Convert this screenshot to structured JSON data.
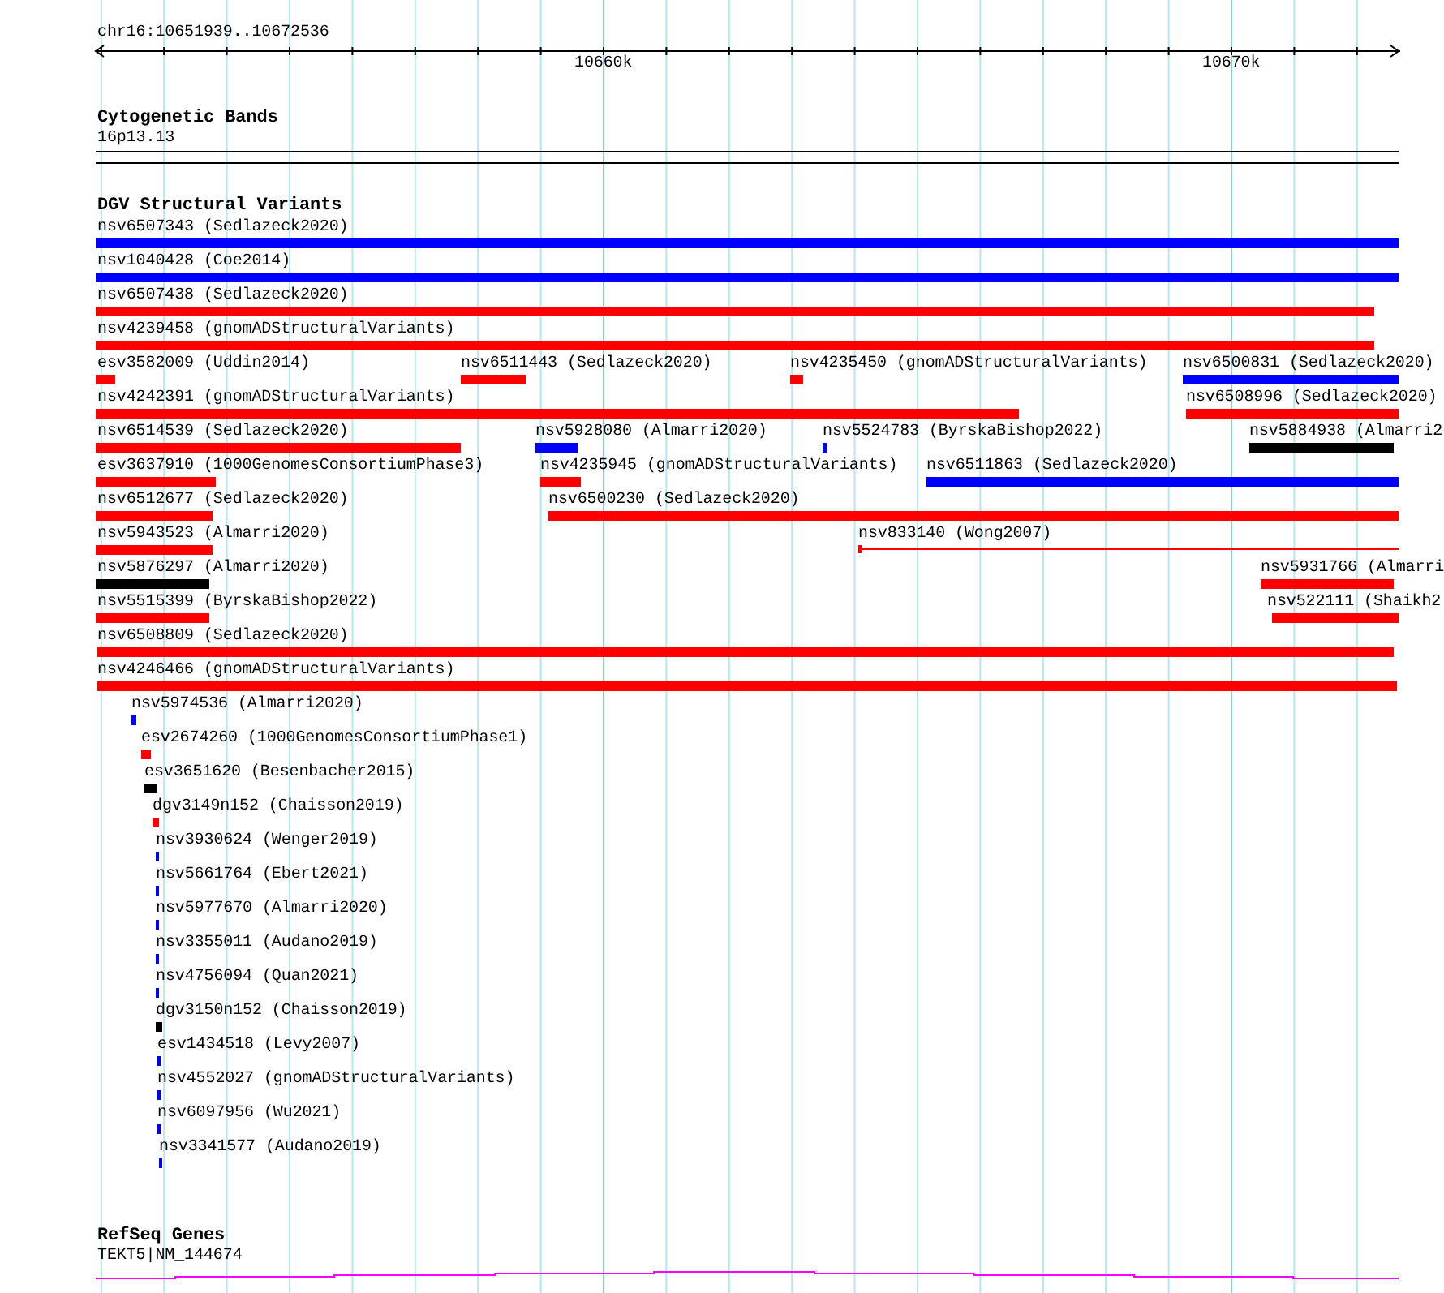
{
  "location": "chr16:10651939..10672536",
  "ruler": {
    "ticks": [
      "10660k",
      "10670k"
    ]
  },
  "cytogenetic_bands": {
    "title": "Cytogenetic Bands",
    "label": "16p13.13"
  },
  "dgv_structural_variants": {
    "title": "DGV Structural Variants",
    "features": [
      {
        "label": "nsv6507343 (Sedlazeck2020)",
        "color": "#0000ff",
        "kind": "bar"
      },
      {
        "label": "nsv1040428 (Coe2014)",
        "color": "#0000ff",
        "kind": "bar"
      },
      {
        "label": "nsv6507438 (Sedlazeck2020)",
        "color": "#ff0000",
        "kind": "bar"
      },
      {
        "label": "nsv4239458 (gnomADStructuralVariants)",
        "color": "#ff0000",
        "kind": "bar"
      },
      {
        "label": "esv3582009 (Uddin2014)",
        "color": "#ff0000",
        "kind": "bar"
      },
      {
        "label": "nsv6511443 (Sedlazeck2020)",
        "color": "#ff0000",
        "kind": "bar"
      },
      {
        "label": "nsv4235450 (gnomADStructuralVariants)",
        "color": "#ff0000",
        "kind": "bar"
      },
      {
        "label": "nsv6500831 (Sedlazeck2020)",
        "color": "#0000ff",
        "kind": "bar"
      },
      {
        "label": "nsv4242391 (gnomADStructuralVariants)",
        "color": "#ff0000",
        "kind": "bar"
      },
      {
        "label": "nsv6508996 (Sedlazeck2020)",
        "color": "#ff0000",
        "kind": "bar"
      },
      {
        "label": "nsv6514539 (Sedlazeck2020)",
        "color": "#ff0000",
        "kind": "bar"
      },
      {
        "label": "nsv5928080 (Almarri2020)",
        "color": "#0000ff",
        "kind": "bar"
      },
      {
        "label": "nsv5524783 (ByrskaBishop2022)",
        "color": "#0000ff",
        "kind": "bar"
      },
      {
        "label": "nsv5884938 (Almarri2",
        "color": "#000000",
        "kind": "bar"
      },
      {
        "label": "esv3637910 (1000GenomesConsortiumPhase3)",
        "color": "#ff0000",
        "kind": "bar"
      },
      {
        "label": "nsv4235945 (gnomADStructuralVariants)",
        "color": "#ff0000",
        "kind": "bar"
      },
      {
        "label": "nsv6511863 (Sedlazeck2020)",
        "color": "#0000ff",
        "kind": "bar"
      },
      {
        "label": "nsv6512677 (Sedlazeck2020)",
        "color": "#ff0000",
        "kind": "bar"
      },
      {
        "label": "nsv6500230 (Sedlazeck2020)",
        "color": "#ff0000",
        "kind": "bar"
      },
      {
        "label": "nsv5943523 (Almarri2020)",
        "color": "#ff0000",
        "kind": "bar"
      },
      {
        "label": "nsv833140 (Wong2007)",
        "color": "#ff0000",
        "kind": "line"
      },
      {
        "label": "nsv5876297 (Almarri2020)",
        "color": "#000000",
        "kind": "bar"
      },
      {
        "label": "nsv5931766 (Almarri",
        "color": "#ff0000",
        "kind": "bar"
      },
      {
        "label": "nsv5515399 (ByrskaBishop2022)",
        "color": "#ff0000",
        "kind": "bar"
      },
      {
        "label": "nsv522111 (Shaikh2",
        "color": "#ff0000",
        "kind": "bar"
      },
      {
        "label": "nsv6508809 (Sedlazeck2020)",
        "color": "#ff0000",
        "kind": "bar"
      },
      {
        "label": "nsv4246466 (gnomADStructuralVariants)",
        "color": "#ff0000",
        "kind": "bar"
      },
      {
        "label": "nsv5974536 (Almarri2020)",
        "color": "#0000ff",
        "kind": "bar"
      },
      {
        "label": "esv2674260 (1000GenomesConsortiumPhase1)",
        "color": "#ff0000",
        "kind": "bar"
      },
      {
        "label": "esv3651620 (Besenbacher2015)",
        "color": "#000000",
        "kind": "bar"
      },
      {
        "label": "dgv3149n152 (Chaisson2019)",
        "color": "#ff0000",
        "kind": "bar"
      },
      {
        "label": "nsv3930624 (Wenger2019)",
        "color": "#0000ff",
        "kind": "bar"
      },
      {
        "label": "nsv5661764 (Ebert2021)",
        "color": "#0000ff",
        "kind": "bar"
      },
      {
        "label": "nsv5977670 (Almarri2020)",
        "color": "#0000ff",
        "kind": "bar"
      },
      {
        "label": "nsv3355011 (Audano2019)",
        "color": "#0000ff",
        "kind": "bar"
      },
      {
        "label": "nsv4756094 (Quan2021)",
        "color": "#0000ff",
        "kind": "bar"
      },
      {
        "label": "dgv3150n152 (Chaisson2019)",
        "color": "#000000",
        "kind": "bar"
      },
      {
        "label": "esv1434518 (Levy2007)",
        "color": "#0000ff",
        "kind": "bar"
      },
      {
        "label": "nsv4552027 (gnomADStructuralVariants)",
        "color": "#0000ff",
        "kind": "bar"
      },
      {
        "label": "nsv6097956 (Wu2021)",
        "color": "#0000ff",
        "kind": "bar"
      },
      {
        "label": "nsv3341577 (Audano2019)",
        "color": "#0000ff",
        "kind": "bar"
      }
    ]
  },
  "refseq_genes": {
    "title": "RefSeq Genes",
    "label": "TEKT5|NM_144674"
  }
}
